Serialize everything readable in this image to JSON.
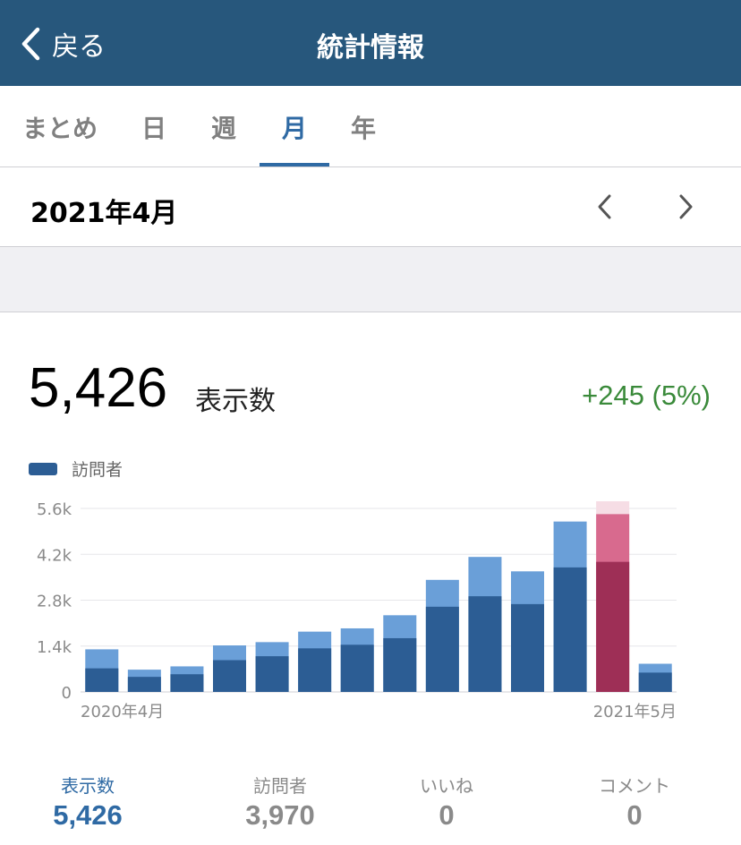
{
  "nav": {
    "back_label": "戻る",
    "title": "統計情報"
  },
  "tabs": [
    {
      "label": "まとめ",
      "active": false
    },
    {
      "label": "日",
      "active": false
    },
    {
      "label": "週",
      "active": false
    },
    {
      "label": "月",
      "active": true
    },
    {
      "label": "年",
      "active": false
    }
  ],
  "period": {
    "label": "2021年4月",
    "prev_icon": "chevron-left-icon",
    "next_icon": "chevron-right-icon"
  },
  "headline": {
    "value": "5,426",
    "unit": "表示数",
    "change": "+245 (5%)"
  },
  "legend": {
    "label": "訪問者"
  },
  "colors": {
    "nav_bg": "#27577c",
    "accent": "#2f6aa4",
    "views": "#6a9fd8",
    "visitors": "#2c5d94",
    "selected_views": "#d86a8e",
    "selected_visitors": "#9e2f56",
    "selected_highlight": "#f6dde5",
    "positive": "#3a8a3a"
  },
  "chart_data": {
    "type": "bar",
    "stacked_overlay": true,
    "categories": [
      "2020-04",
      "2020-05",
      "2020-06",
      "2020-07",
      "2020-08",
      "2020-09",
      "2020-10",
      "2020-11",
      "2020-12",
      "2021-01",
      "2021-02",
      "2021-03",
      "2021-04",
      "2021-05"
    ],
    "x_tick_labels": {
      "first": "2020年4月",
      "last": "2021年5月"
    },
    "series": [
      {
        "name": "表示数",
        "values": [
          1300,
          680,
          780,
          1420,
          1520,
          1840,
          1940,
          2340,
          3420,
          4120,
          3680,
          5200,
          5426,
          860
        ]
      },
      {
        "name": "訪問者",
        "values": [
          720,
          460,
          540,
          970,
          1090,
          1330,
          1440,
          1640,
          2600,
          2920,
          2680,
          3800,
          3970,
          590
        ]
      }
    ],
    "selected_index": 12,
    "yticks": [
      "0",
      "1.4k",
      "2.8k",
      "4.2k",
      "5.6k"
    ],
    "ytick_values": [
      0,
      1400,
      2800,
      4200,
      5600
    ],
    "ylim": [
      0,
      5600
    ],
    "grid": true
  },
  "stats": [
    {
      "label": "表示数",
      "value": "5,426",
      "active": true
    },
    {
      "label": "訪問者",
      "value": "3,970",
      "active": false
    },
    {
      "label": "いいね",
      "value": "0",
      "active": false
    },
    {
      "label": "コメント",
      "value": "0",
      "active": false
    }
  ]
}
